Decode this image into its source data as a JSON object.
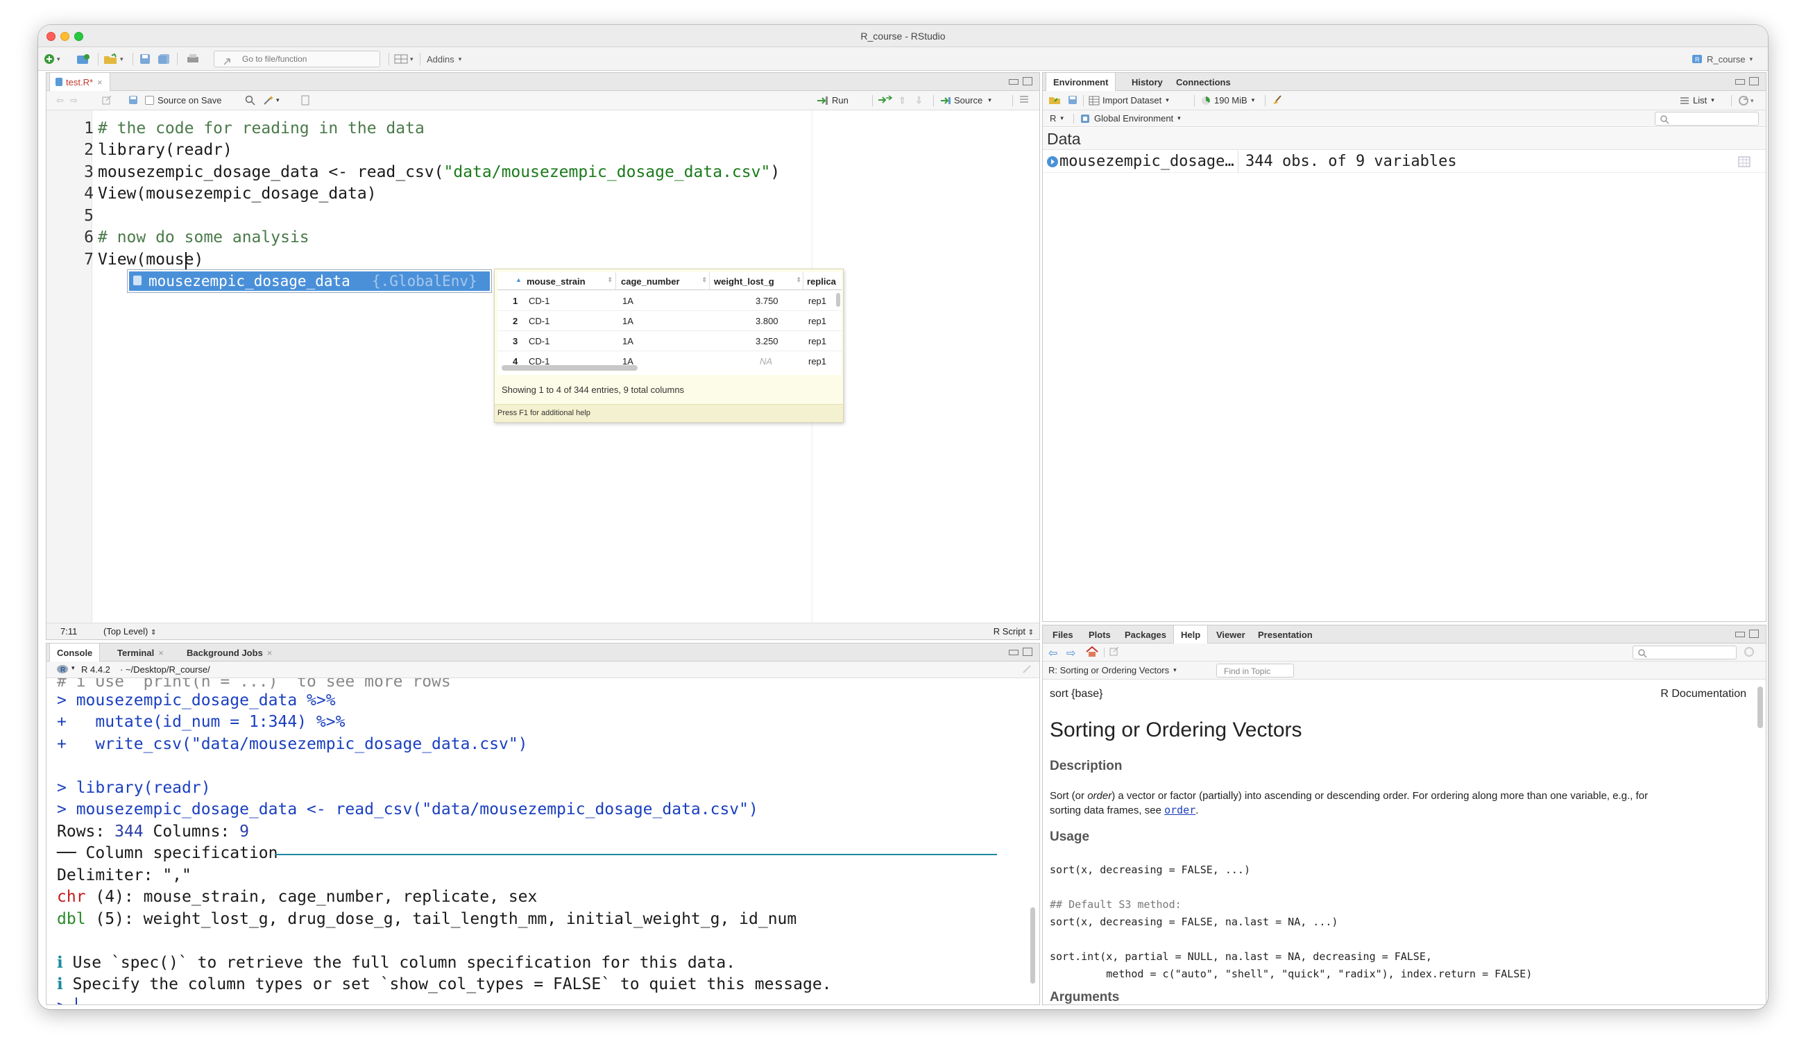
{
  "window": {
    "title": "R_course - RStudio"
  },
  "toolbar": {
    "goto_placeholder": "Go to file/function",
    "addins": "Addins",
    "project": "R_course"
  },
  "source": {
    "tab": "test.R*",
    "source_on_save": "Source on Save",
    "run": "Run",
    "source_btn": "Source",
    "lines": [
      "1",
      "2",
      "3",
      "4",
      "5",
      "6",
      "7"
    ],
    "code": {
      "l1": "# the code for reading in the data",
      "l2a": "library",
      "l2b": "(readr)",
      "l3a": "mousezempic_dosage_data <- read_csv(",
      "l3b": "\"data/mousezempic_dosage_data.csv\"",
      "l3c": ")",
      "l4": "View(mousezempic_dosage_data)",
      "l6": "# now do some analysis",
      "l7": "View(mouse)"
    },
    "status": {
      "pos": "7:11",
      "scope": "(Top Level)",
      "type": "R Script"
    }
  },
  "autocomplete": {
    "item": "mousezempic_dosage_data",
    "env": "{.GlobalEnv}",
    "preview": {
      "columns": [
        "mouse_strain",
        "cage_number",
        "weight_lost_g",
        "replica"
      ],
      "rows": [
        [
          "1",
          "CD-1",
          "1A",
          "3.750",
          "rep1"
        ],
        [
          "2",
          "CD-1",
          "1A",
          "3.800",
          "rep1"
        ],
        [
          "3",
          "CD-1",
          "1A",
          "3.250",
          "rep1"
        ],
        [
          "4",
          "CD-1",
          "1A",
          "NA",
          "rep1"
        ]
      ],
      "info": "Showing 1 to 4 of 344 entries, 9 total columns",
      "help": "Press F1 for additional help"
    }
  },
  "console": {
    "tabs": [
      "Console",
      "Terminal",
      "Background Jobs"
    ],
    "rversion": "R 4.4.2",
    "path": "~/Desktop/R_course/",
    "lines": {
      "c0": "# i Use `print(n = ...)` to see more rows",
      "c1": "> mousezempic_dosage_data %>%",
      "c2": "+   mutate(id_num = 1:344) %>%",
      "c3": "+   write_csv(\"data/mousezempic_dosage_data.csv\")",
      "c4": "> library(readr)",
      "c5": "> mousezempic_dosage_data <- read_csv(\"data/mousezempic_dosage_data.csv\")",
      "c6a": "Rows: ",
      "c6b": "344",
      "c6c": " Columns: ",
      "c6d": "9",
      "c7": "── Column specification ",
      "c8": "Delimiter: \",\"",
      "c9a": "chr",
      "c9b": " (4): mouse_strain, cage_number, replicate, sex",
      "c10a": "dbl",
      "c10b": " (5): weight_lost_g, drug_dose_g, tail_length_mm, initial_weight_g, id_num",
      "c11a": "ℹ",
      "c11b": " Use `spec()` to retrieve the full column specification for this data.",
      "c12a": "ℹ",
      "c12b": " Specify the column types or set `show_col_types = FALSE` to quiet this message.",
      "c13": ">"
    }
  },
  "env": {
    "tabs": [
      "Environment",
      "History",
      "Connections"
    ],
    "import": "Import Dataset",
    "mem": "190 MiB",
    "list": "List",
    "lang": "R",
    "scope": "Global Environment",
    "section": "Data",
    "obj_name": "mousezempic_dosage…",
    "obj_desc": "344 obs. of 9 variables"
  },
  "help": {
    "tabs": [
      "Files",
      "Plots",
      "Packages",
      "Help",
      "Viewer",
      "Presentation"
    ],
    "topic": "R: Sorting or Ordering Vectors",
    "find_placeholder": "Find in Topic",
    "pkg": "sort {base}",
    "rdoc": "R Documentation",
    "title": "Sorting or Ordering Vectors",
    "desc_h": "Description",
    "desc1": "Sort (or ",
    "desc_em": "order",
    "desc2": ") a vector or factor (partially) into ascending or descending order. For ordering along more than one variable, e.g., for",
    "desc3": "sorting data frames, see ",
    "desc_link": "order",
    "desc4": ".",
    "usage_h": "Usage",
    "u1": "sort(x, decreasing = FALSE, ...)",
    "u2": "## Default S3 method:",
    "u3": "sort(x, decreasing = FALSE, na.last = NA, ...)",
    "u4": "sort.int(x, partial = NULL, na.last = NA, decreasing = FALSE,",
    "u5": "         method = c(\"auto\", \"shell\", \"quick\", \"radix\"), index.return = FALSE)",
    "args_h": "Arguments"
  }
}
